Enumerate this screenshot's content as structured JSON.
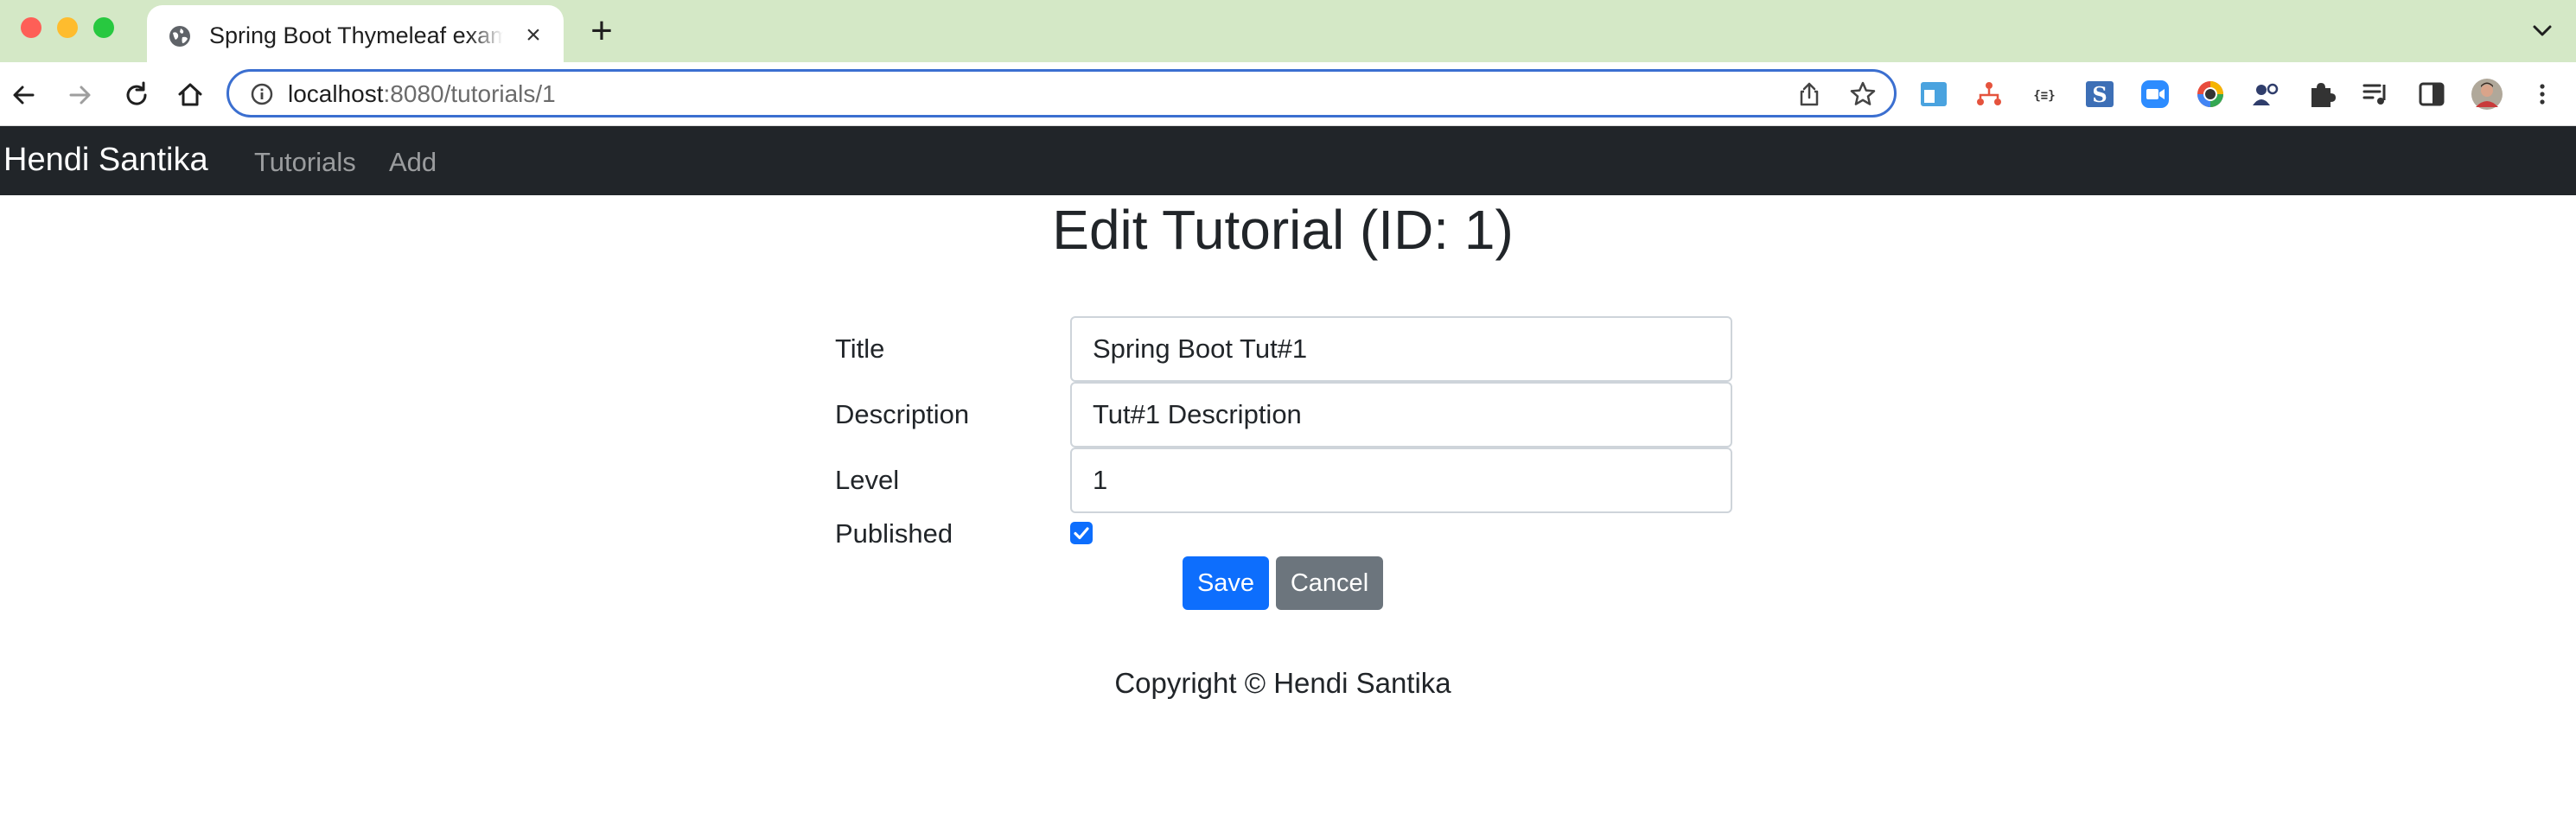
{
  "browser": {
    "tab_title": "Spring Boot Thymeleaf example",
    "new_tab_symbol": "+",
    "close_symbol": "×",
    "url_host": "localhost",
    "url_path": ":8080/tutorials/1"
  },
  "navbar": {
    "brand": "Hendi Santika",
    "links": [
      {
        "label": "Tutorials"
      },
      {
        "label": "Add"
      }
    ],
    "background": "#212529"
  },
  "page": {
    "title": "Edit Tutorial (ID: 1)"
  },
  "form": {
    "title_label": "Title",
    "title_value": "Spring Boot Tut#1",
    "description_label": "Description",
    "description_value": "Tut#1 Description",
    "level_label": "Level",
    "level_value": "1",
    "published_label": "Published",
    "published_checked": true,
    "save_label": "Save",
    "cancel_label": "Cancel",
    "accent": "#0d6efd",
    "secondary": "#6c757d"
  },
  "footer": {
    "text": "Copyright © Hendi Santika"
  }
}
